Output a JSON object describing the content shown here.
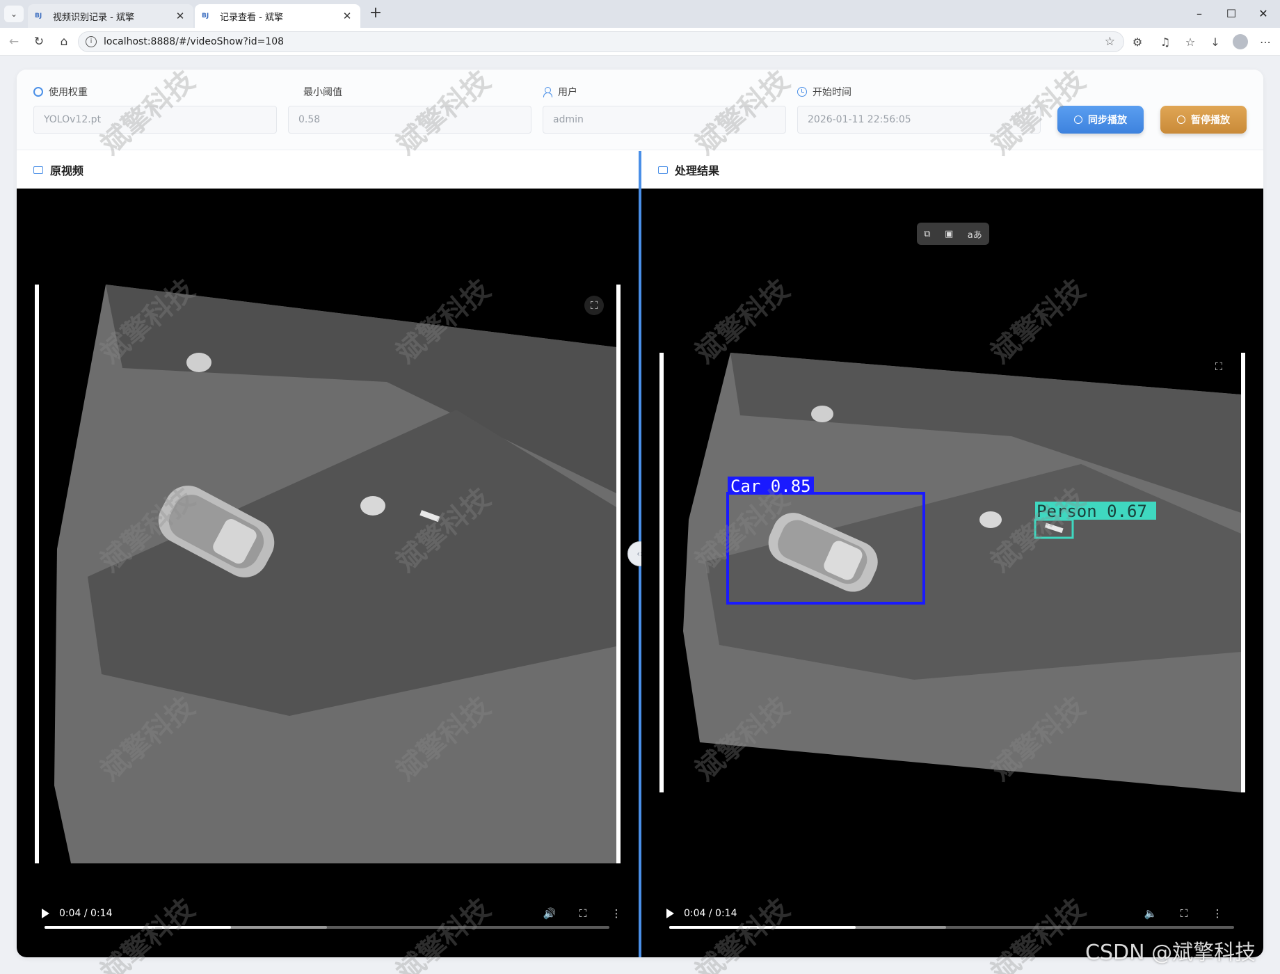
{
  "browser": {
    "tabs": [
      {
        "favicon": "BJ",
        "title": "视频识别记录 - 斌擎",
        "active": false
      },
      {
        "favicon": "BJ",
        "title": "记录查看 - 斌擎",
        "active": true
      }
    ],
    "url": "localhost:8888/#/videoShow?id=108"
  },
  "filters": {
    "weight": {
      "label": "使用权重",
      "value": "YOLOv12.pt",
      "icon": "gear-icon"
    },
    "threshold": {
      "label": "最小阈值",
      "value": "0.58"
    },
    "user": {
      "label": "用户",
      "value": "admin",
      "icon": "user-icon"
    },
    "start_time": {
      "label": "开始时间",
      "value": "2026-01-11 22:56:05",
      "icon": "clock-icon"
    }
  },
  "buttons": {
    "sync_play": "同步播放",
    "pause_play": "暂停播放"
  },
  "panes": {
    "original": {
      "title": "原视频",
      "time": "0:04 / 0:14",
      "played_fraction": 0.33,
      "buffered_fraction": 0.5
    },
    "result": {
      "title": "处理结果",
      "time": "0:04 / 0:14",
      "played_fraction": 0.33,
      "buffered_fraction": 0.49,
      "detections": [
        {
          "label": "Car 0.85",
          "color": "#1a1aff"
        },
        {
          "label": "Person 0.67",
          "color": "#3fd8c0"
        }
      ],
      "float_tools": [
        "screen-capture-icon",
        "picture-in-picture-icon",
        "translate-icon"
      ]
    }
  },
  "watermark": "斌擎科技",
  "credit": "CSDN @斌擎科技",
  "colors": {
    "accent": "#4a8fe7",
    "sync_button": "#4a8fe7",
    "pause_button": "#d49a45"
  }
}
